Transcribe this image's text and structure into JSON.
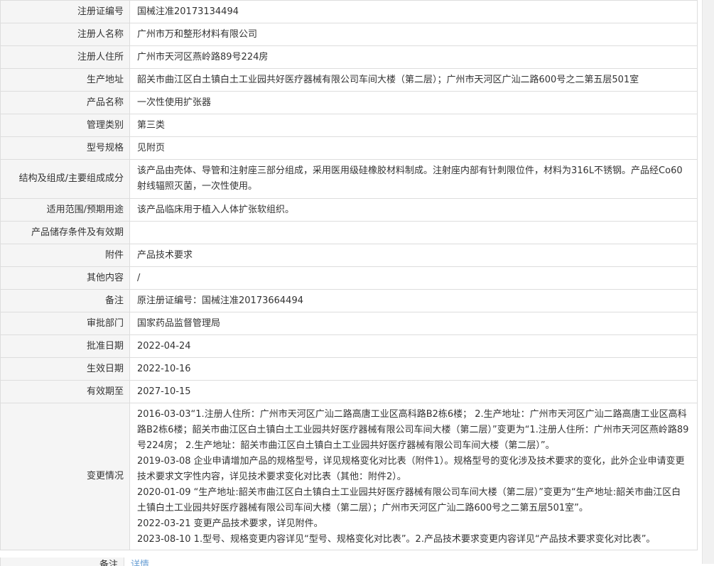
{
  "rows": [
    {
      "label": "注册证编号",
      "value": "国械注准20173134494"
    },
    {
      "label": "注册人名称",
      "value": "广州市万和整形材料有限公司"
    },
    {
      "label": "注册人住所",
      "value": "广州市天河区燕岭路89号224房"
    },
    {
      "label": "生产地址",
      "value": "韶关市曲江区白土镇白土工业园共好医疗器械有限公司车间大楼（第二层）；广州市天河区广汕二路600号之二第五层501室"
    },
    {
      "label": "产品名称",
      "value": "一次性使用扩张器"
    },
    {
      "label": "管理类别",
      "value": "第三类"
    },
    {
      "label": "型号规格",
      "value": "见附页"
    },
    {
      "label": "结构及组成/主要组成成分",
      "value": "该产品由壳体、导管和注射座三部分组成，采用医用级硅橡胶材料制成。注射座内部有针刺限位件，材料为316L不锈钢。产品经Co60射线辐照灭菌，一次性使用。"
    },
    {
      "label": "适用范围/预期用途",
      "value": "该产品临床用于植入人体扩张软组织。"
    },
    {
      "label": "产品储存条件及有效期",
      "value": ""
    },
    {
      "label": "附件",
      "value": "产品技术要求"
    },
    {
      "label": "其他内容",
      "value": "/"
    },
    {
      "label": "备注",
      "value": "原注册证编号：国械注准20173664494"
    },
    {
      "label": "审批部门",
      "value": "国家药品监督管理局"
    },
    {
      "label": "批准日期",
      "value": "2022-04-24"
    },
    {
      "label": "生效日期",
      "value": "2022-10-16"
    },
    {
      "label": "有效期至",
      "value": "2027-10-15"
    }
  ],
  "change": {
    "label": "变更情况",
    "entries": [
      "2016-03-03“1.注册人住所：广州市天河区广汕二路高唐工业区高科路B2栋6楼； 2.生产地址：广州市天河区广汕二路高唐工业区高科路B2栋6楼；韶关市曲江区白土镇白土工业园共好医疗器械有限公司车间大楼（第二层）”变更为“1.注册人住所：广州市天河区燕岭路89号224房； 2.生产地址：韶关市曲江区白土镇白土工业园共好医疗器械有限公司车间大楼（第二层）”。",
      "2019-03-08 企业申请增加产品的规格型号，详见规格变化对比表（附件1）。规格型号的变化涉及技术要求的变化，此外企业申请变更技术要求文字性内容，详见技术要求变化对比表（其他：附件2）。",
      "2020-01-09 “生产地址:韶关市曲江区白土镇白土工业园共好医疗器械有限公司车间大楼（第二层）”变更为“生产地址:韶关市曲江区白土镇白土工业园共好医疗器械有限公司车间大楼（第二层）；广州市天河区广汕二路600号之二第五层501室”。",
      "2022-03-21 变更产品技术要求，详见附件。",
      "2023-08-10 1.型号、规格变更内容详见“型号、规格变化对比表”。2.产品技术要求变更内容详见“产品技术要求变化对比表”。"
    ]
  },
  "cut_row": {
    "label": "备注",
    "value": "详情"
  },
  "colors": {
    "label_bg": "#f5f5f5",
    "border": "#dddddd",
    "text": "#333333"
  }
}
